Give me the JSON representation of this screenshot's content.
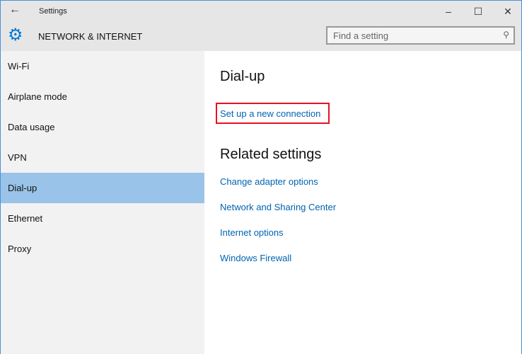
{
  "window": {
    "title": "Settings",
    "back_icon": "arrow-left-icon"
  },
  "header": {
    "section": "NETWORK & INTERNET",
    "search_placeholder": "Find a setting"
  },
  "sidebar": {
    "items": [
      {
        "label": "Wi-Fi"
      },
      {
        "label": "Airplane mode"
      },
      {
        "label": "Data usage"
      },
      {
        "label": "VPN"
      },
      {
        "label": "Dial-up",
        "selected": true
      },
      {
        "label": "Ethernet"
      },
      {
        "label": "Proxy"
      }
    ]
  },
  "main": {
    "title": "Dial-up",
    "setup_link": "Set up a new connection",
    "related_title": "Related settings",
    "related": [
      "Change adapter options",
      "Network and Sharing Center",
      "Internet options",
      "Windows Firewall"
    ]
  },
  "colors": {
    "accent": "#0078d7",
    "link": "#0063b1",
    "selected": "#99c3e8",
    "highlight": "#e81123"
  }
}
